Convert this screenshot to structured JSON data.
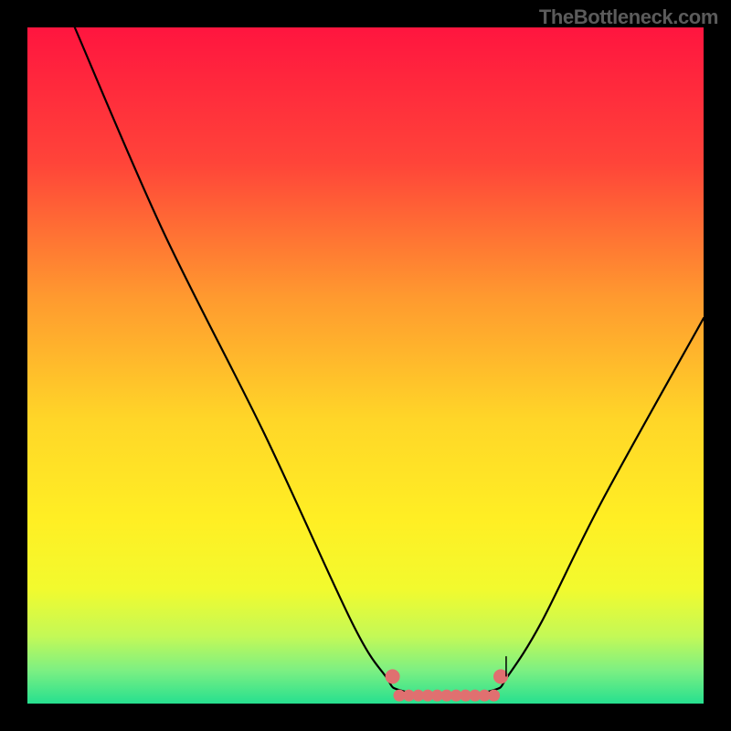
{
  "watermark": "TheBottleneck.com",
  "chart_data": {
    "type": "line",
    "title": "",
    "xlabel": "",
    "ylabel": "",
    "xlim": [
      0,
      100
    ],
    "ylim": [
      0,
      100
    ],
    "curve": {
      "name": "bottleneck-curve",
      "points": [
        {
          "x": 7,
          "y": 100
        },
        {
          "x": 20,
          "y": 70
        },
        {
          "x": 35,
          "y": 40
        },
        {
          "x": 48,
          "y": 12
        },
        {
          "x": 53,
          "y": 4
        },
        {
          "x": 55,
          "y": 2
        },
        {
          "x": 62,
          "y": 1
        },
        {
          "x": 69,
          "y": 2
        },
        {
          "x": 71,
          "y": 4
        },
        {
          "x": 76,
          "y": 12
        },
        {
          "x": 85,
          "y": 30
        },
        {
          "x": 100,
          "y": 57
        }
      ],
      "optimal_region": {
        "x_start": 55,
        "x_end": 69,
        "y": 2
      }
    },
    "gradient": {
      "type": "vertical",
      "stops": [
        {
          "pos": 0.0,
          "color": "#ff153f"
        },
        {
          "pos": 0.2,
          "color": "#ff4439"
        },
        {
          "pos": 0.4,
          "color": "#ff9a2f"
        },
        {
          "pos": 0.58,
          "color": "#ffd628"
        },
        {
          "pos": 0.73,
          "color": "#ffef24"
        },
        {
          "pos": 0.83,
          "color": "#f2fa2e"
        },
        {
          "pos": 0.9,
          "color": "#c4f956"
        },
        {
          "pos": 0.95,
          "color": "#7ef082"
        },
        {
          "pos": 1.0,
          "color": "#26e08f"
        }
      ]
    }
  }
}
